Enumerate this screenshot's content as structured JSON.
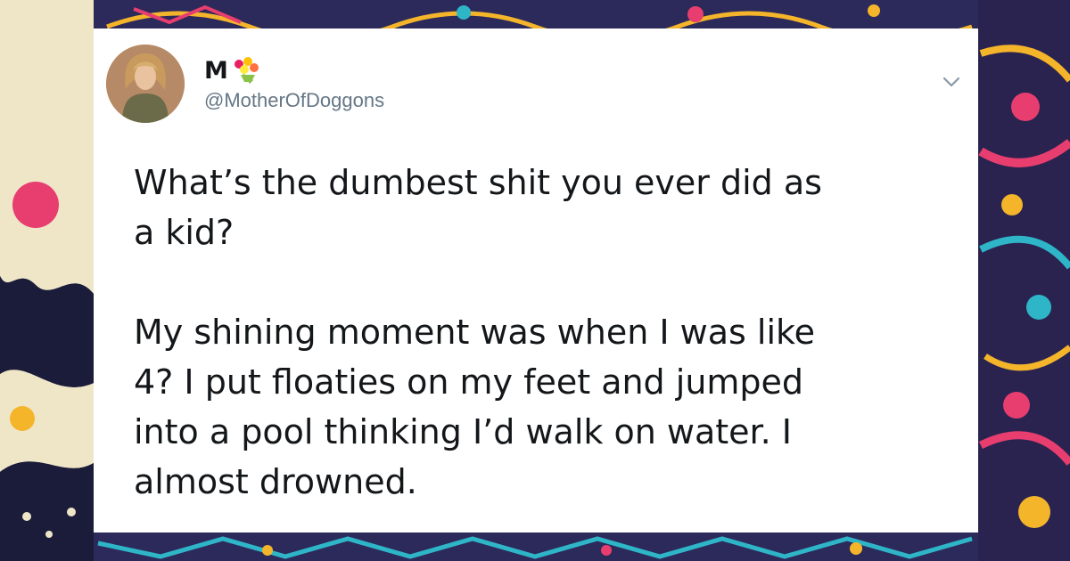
{
  "tweet": {
    "display_name": "M",
    "name_emoji": "bouquet-icon",
    "handle": "@MotherOfDoggons",
    "text": "What’s the dumbest shit you ever did as\na kid?\n\nMy shining moment was when I was like\n4? I put floaties on my feet and jumped\ninto a pool thinking I’d walk on water. I\nalmost drowned."
  },
  "colors": {
    "text_primary": "#14171a",
    "text_secondary": "#657786",
    "card_background": "#ffffff"
  }
}
